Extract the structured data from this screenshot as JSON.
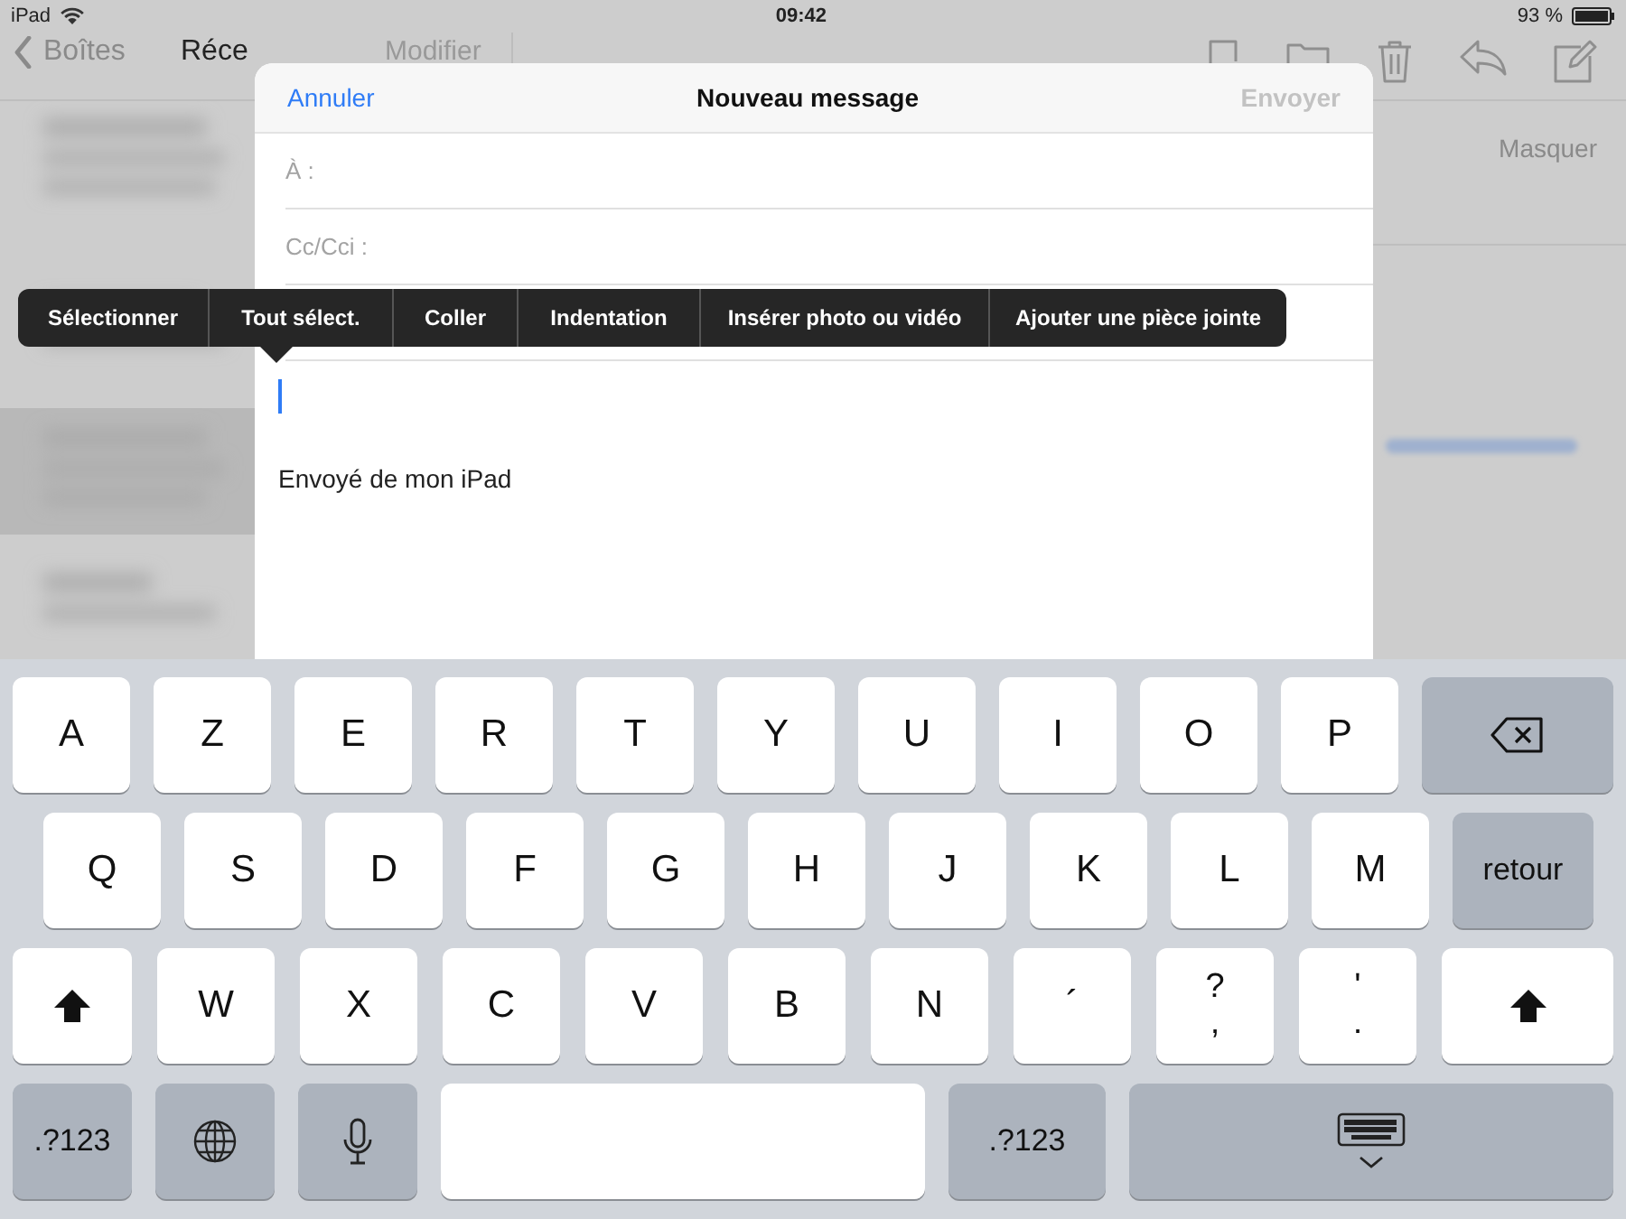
{
  "status_bar": {
    "device": "iPad",
    "time": "09:42",
    "battery": "93 %"
  },
  "mail_nav": {
    "back": "Boîtes",
    "title": "Réce",
    "edit": "Modifier"
  },
  "message_pane": {
    "hide": "Masquer"
  },
  "compose": {
    "cancel": "Annuler",
    "title": "Nouveau message",
    "send": {
      "label": "Envoyer",
      "disabled": true
    },
    "fields": [
      {
        "label": "À :"
      },
      {
        "label": "Cc/Cci :"
      }
    ],
    "signature": "Envoyé de mon iPad"
  },
  "edit_menu": {
    "items": [
      "Sélectionner",
      "Tout sélect.",
      "Coller",
      "Indentation",
      "Insérer photo ou vidéo",
      "Ajouter une pièce jointe"
    ]
  },
  "keyboard": {
    "rows": [
      [
        {
          "kind": "char",
          "label": "A"
        },
        {
          "kind": "char",
          "label": "Z"
        },
        {
          "kind": "char",
          "label": "E"
        },
        {
          "kind": "char",
          "label": "R"
        },
        {
          "kind": "char",
          "label": "T"
        },
        {
          "kind": "char",
          "label": "Y"
        },
        {
          "kind": "char",
          "label": "U"
        },
        {
          "kind": "char",
          "label": "I"
        },
        {
          "kind": "char",
          "label": "O"
        },
        {
          "kind": "char",
          "label": "P"
        },
        {
          "kind": "delete"
        }
      ],
      [
        {
          "kind": "char",
          "label": "Q"
        },
        {
          "kind": "char",
          "label": "S"
        },
        {
          "kind": "char",
          "label": "D"
        },
        {
          "kind": "char",
          "label": "F"
        },
        {
          "kind": "char",
          "label": "G"
        },
        {
          "kind": "char",
          "label": "H"
        },
        {
          "kind": "char",
          "label": "J"
        },
        {
          "kind": "char",
          "label": "K"
        },
        {
          "kind": "char",
          "label": "L"
        },
        {
          "kind": "char",
          "label": "M"
        },
        {
          "kind": "return",
          "label": "retour"
        }
      ],
      [
        {
          "kind": "shift"
        },
        {
          "kind": "char",
          "label": "W"
        },
        {
          "kind": "char",
          "label": "X"
        },
        {
          "kind": "char",
          "label": "C"
        },
        {
          "kind": "char",
          "label": "V"
        },
        {
          "kind": "char",
          "label": "B"
        },
        {
          "kind": "char",
          "label": "N"
        },
        {
          "kind": "char",
          "label": "´"
        },
        {
          "kind": "dual",
          "top": "?",
          "bottom": ","
        },
        {
          "kind": "dual",
          "top": "'",
          "bottom": "."
        },
        {
          "kind": "shift"
        }
      ],
      [
        {
          "kind": "numbers",
          "label": ".?123"
        },
        {
          "kind": "globe"
        },
        {
          "kind": "mic"
        },
        {
          "kind": "space"
        },
        {
          "kind": "numbers",
          "label": ".?123"
        },
        {
          "kind": "hide"
        }
      ]
    ]
  }
}
